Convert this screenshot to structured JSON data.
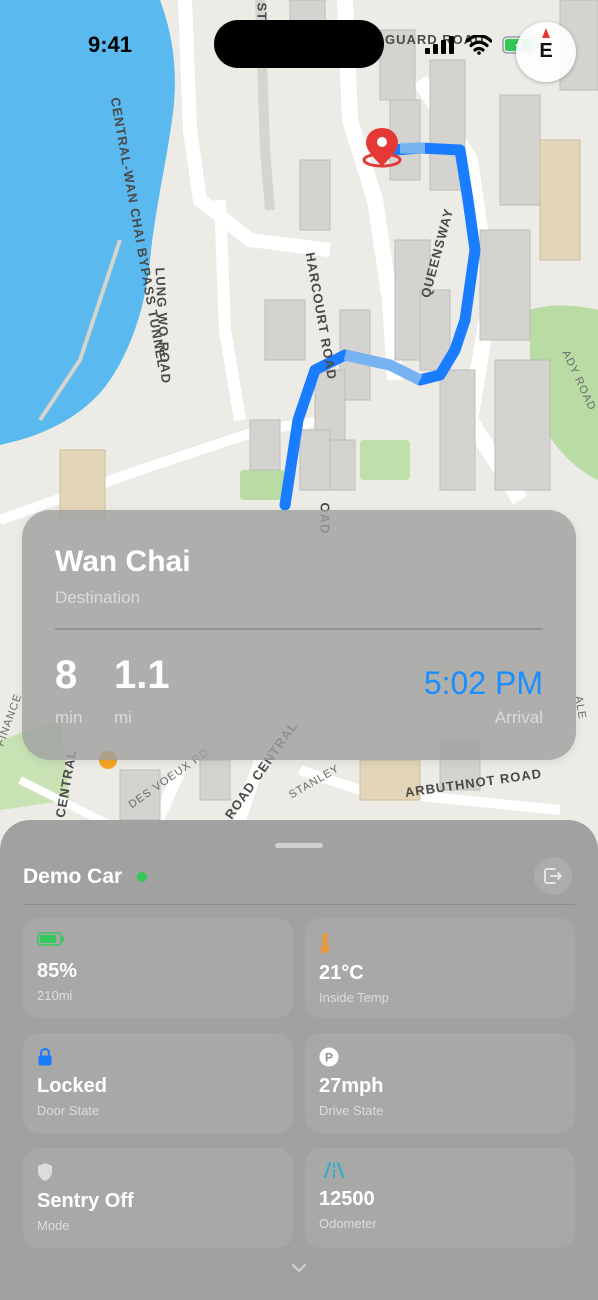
{
  "status_bar": {
    "time": "9:41"
  },
  "compass": {
    "heading": "E"
  },
  "map": {
    "road_labels": {
      "harcourt": "HARCOURT ROAD",
      "lung_wo": "LUNG WO ROAD",
      "queensway": "QUEENSWAY",
      "bypass": "CENTRAL-WAN CHAI BYPASS TUNNEL",
      "guard": "GUARD ROAD",
      "arbuthnot": "ARBUTHNOT ROAD",
      "stanley": "STANLEY",
      "voeux": "DES VOEUX RD",
      "road_central": "ROAD CENTRAL",
      "central": "CENTRAL",
      "street": "STREET",
      "finance": "FINANCE",
      "alex": "ALE",
      "ady": "ADY ROAD",
      "oad": "OAD"
    }
  },
  "trip": {
    "destination": "Wan Chai",
    "destination_label": "Destination",
    "duration_value": "8",
    "duration_unit": "min",
    "distance_value": "1.1",
    "distance_unit": "mi",
    "arrival_time": "5:02 PM",
    "arrival_label": "Arrival"
  },
  "vehicle": {
    "name": "Demo Car",
    "tiles": {
      "battery": {
        "value": "85%",
        "label": "210mi",
        "icon": "battery-icon",
        "level": 0.85
      },
      "temp": {
        "value": "21°C",
        "label": "Inside Temp",
        "icon": "thermometer-icon"
      },
      "lock": {
        "value": "Locked",
        "label": "Door State",
        "icon": "lock-icon"
      },
      "drive": {
        "value": "27mph",
        "label": "Drive State",
        "icon": "park-icon"
      },
      "sentry": {
        "value": "Sentry Off",
        "label": "Mode",
        "icon": "shield-icon"
      },
      "odometer": {
        "value": "12500",
        "label": "Odometer",
        "icon": "road-icon"
      }
    }
  },
  "colors": {
    "route": "#1a7cff",
    "arrival": "#1a8dff",
    "online": "#34c759",
    "battery": "#34c759",
    "temp": "#e69a3c",
    "lock": "#1a7cff",
    "odometer": "#2fb0c6",
    "water": "#5ab9ef"
  }
}
